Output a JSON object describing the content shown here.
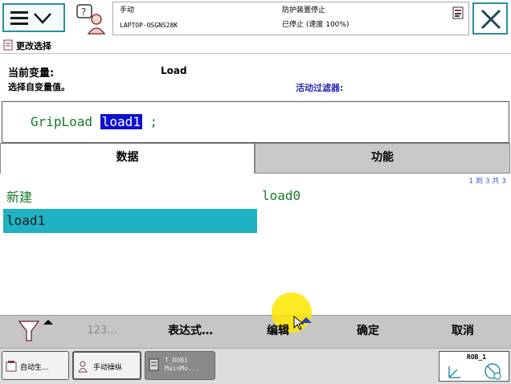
{
  "status": {
    "mode": "手动",
    "system": "LAPTOP-OSGNS28K",
    "safety": "防护装置停止",
    "state": "已停止 (速度 100%)"
  },
  "header": {
    "title": "更改选择"
  },
  "variable": {
    "current_label": "当前变量:",
    "current_value": "Load",
    "choose_label": "选择自变量值。",
    "filter_label": "活动过滤器:"
  },
  "expression": {
    "prefix": "GripLoad ",
    "selected": "load1",
    "suffix": " ;"
  },
  "tabs": [
    {
      "label": "数据"
    },
    {
      "label": "功能"
    }
  ],
  "pager": "1 到 3 共 3",
  "items": [
    {
      "label": "新建"
    },
    {
      "label": "load0"
    },
    {
      "label": "load1"
    }
  ],
  "toolbar": {
    "numpad_label": "123...",
    "expression_label": "表达式…",
    "edit_label": "编辑",
    "ok_label": "确定",
    "cancel_label": "取消"
  },
  "taskbar": [
    {
      "label": "自动生..."
    },
    {
      "label": "手动操纵"
    },
    {
      "label": "T_ROB1\nMainMo..."
    }
  ],
  "robot": {
    "label": "ROB_1"
  },
  "colors": {
    "accent": "#2a8fa0",
    "selection": "#1eb2c2",
    "expr_selection": "#1010d0",
    "code_text": "#1a7a2a"
  }
}
